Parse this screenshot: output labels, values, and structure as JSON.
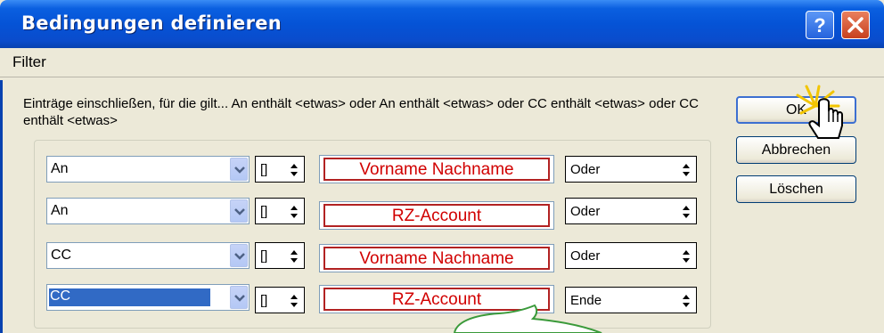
{
  "window": {
    "title": "Bedingungen definieren"
  },
  "menu": {
    "filter": "Filter"
  },
  "description": "Einträge einschließen, für die gilt... An  enthält <etwas> oder An  enthält <etwas> oder CC  enthält <etwas> oder CC  enthält <etwas>",
  "buttons": {
    "ok": "OK",
    "cancel": "Abbrechen",
    "delete": "Löschen"
  },
  "conditions": [
    {
      "field": "An",
      "operator": "[]",
      "value": "Vorname Nachname",
      "conjunction": "Oder"
    },
    {
      "field": "An",
      "operator": "[]",
      "value": "RZ-Account",
      "conjunction": "Oder"
    },
    {
      "field": "CC",
      "operator": "[]",
      "value": "Vorname Nachname",
      "conjunction": "Oder"
    },
    {
      "field": "CC",
      "operator": "[]",
      "value": "RZ-Account",
      "conjunction": "Ende"
    }
  ],
  "icons": [
    "help-icon",
    "close-icon",
    "chevron-down-icon",
    "spin-arrows-icon",
    "hand-pointer-icon",
    "speech-bubble-icon"
  ],
  "colors": {
    "titlebar": "#0553d6",
    "highlight": "#316ac5",
    "annotation_red": "#d10000"
  }
}
